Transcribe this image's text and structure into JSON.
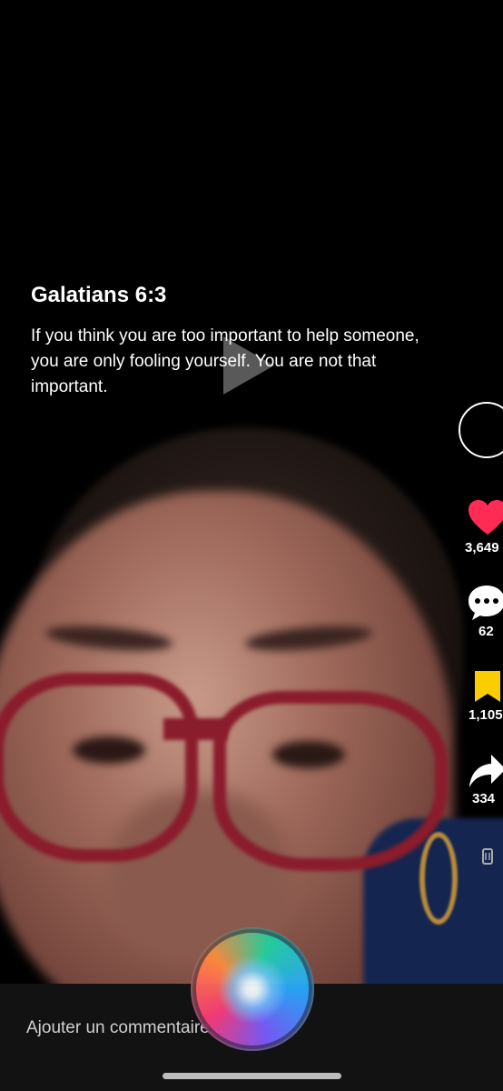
{
  "caption": {
    "title": "Galatians 6:3",
    "text": "If you think you are too important to help someone, you are only fooling yourself. You are not that important."
  },
  "actions": {
    "like_count": "3,649",
    "comment_count": "62",
    "bookmark_count": "1,105",
    "share_count": "334"
  },
  "comment_bar": {
    "placeholder": "Ajouter un commentaire..."
  },
  "colors": {
    "like": "#fe2c55",
    "bookmark": "#facd00",
    "status_dot": "#ff9500"
  },
  "icons": [
    "play-icon",
    "heart-icon",
    "comment-icon",
    "bookmark-icon",
    "share-icon",
    "music-disc-icon",
    "siri-orb-icon"
  ]
}
